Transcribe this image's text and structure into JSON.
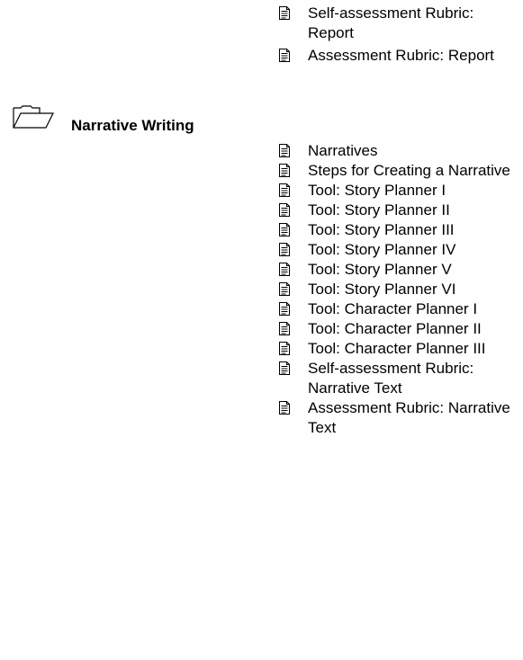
{
  "top_items": [
    {
      "label": "Self-assessment Rubric: Report",
      "icon": "document-icon"
    },
    {
      "label": "Assessment Rubric: Report",
      "icon": "document-icon"
    }
  ],
  "section": {
    "title": "Narrative Writing",
    "icon": "folder-icon"
  },
  "items": [
    {
      "label": "Narratives",
      "icon": "document-icon"
    },
    {
      "label": "Steps for Creating a Narrative",
      "icon": "document-icon"
    },
    {
      "label": "Tool: Story Planner I",
      "icon": "document-icon"
    },
    {
      "label": "Tool: Story Planner II",
      "icon": "document-icon"
    },
    {
      "label": "Tool: Story Planner III",
      "icon": "document-icon"
    },
    {
      "label": "Tool: Story Planner IV",
      "icon": "document-icon"
    },
    {
      "label": "Tool: Story Planner V",
      "icon": "document-icon"
    },
    {
      "label": "Tool: Story Planner VI",
      "icon": "document-icon"
    },
    {
      "label": "Tool: Character Planner I",
      "icon": "document-icon"
    },
    {
      "label": "Tool: Character Planner II",
      "icon": "document-icon"
    },
    {
      "label": "Tool: Character Planner III",
      "icon": "document-icon"
    },
    {
      "label": "Self-assessment Rubric: Narrative Text",
      "icon": "document-icon"
    },
    {
      "label": "Assessment Rubric: Narrative Text",
      "icon": "document-icon"
    }
  ]
}
